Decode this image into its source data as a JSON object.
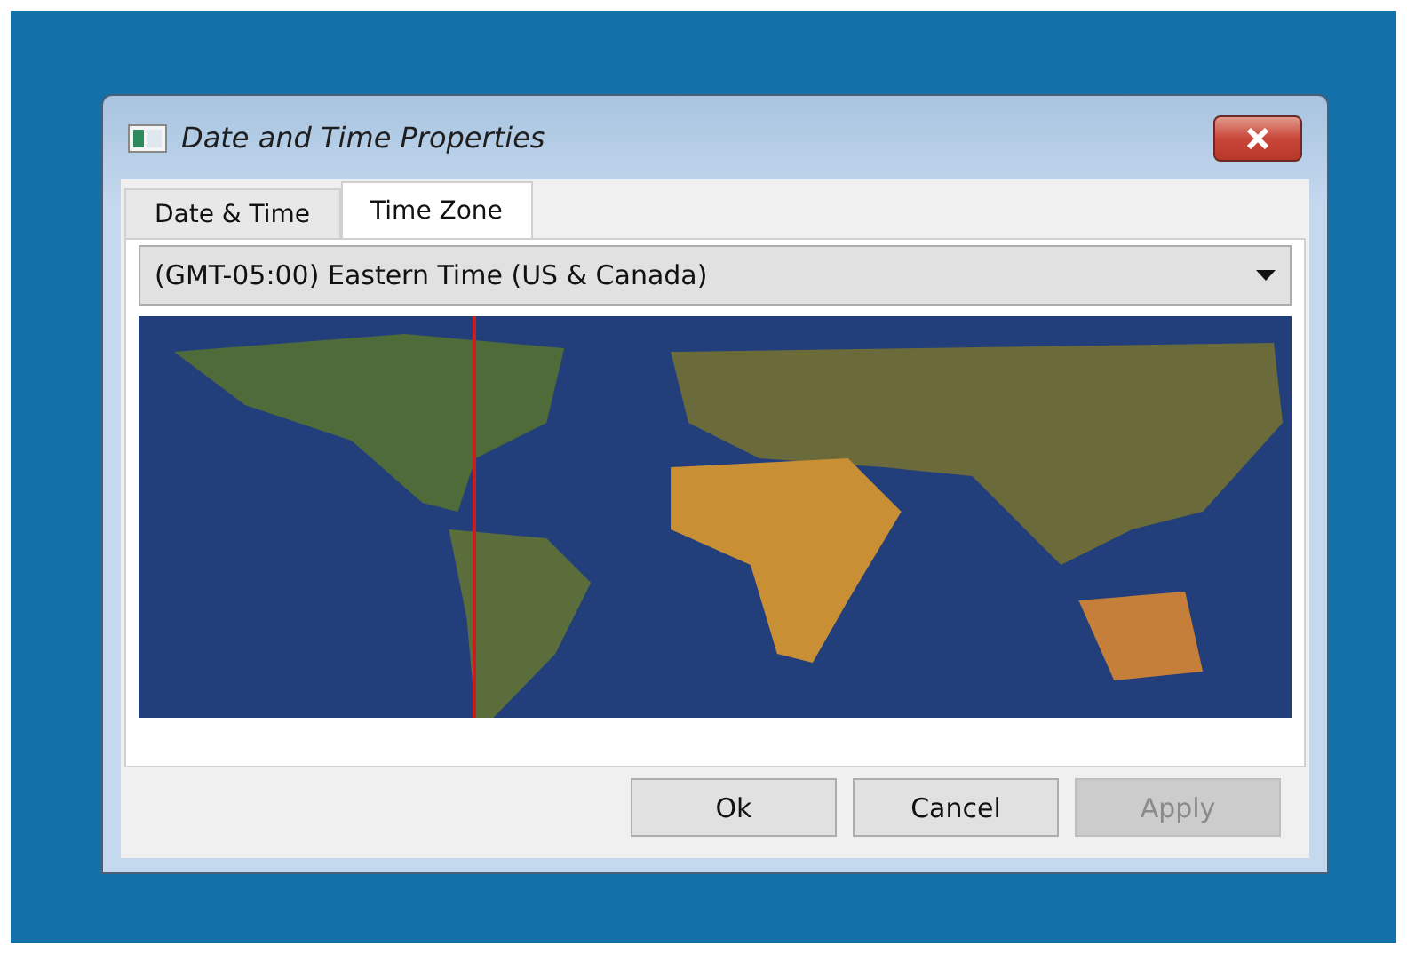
{
  "window": {
    "title": "Date and Time Properties"
  },
  "tabs": [
    {
      "label": "Date & Time",
      "selected": false
    },
    {
      "label": "Time Zone",
      "selected": true
    }
  ],
  "timezone_dropdown": {
    "value": "(GMT-05:00) Eastern Time (US & Canada)"
  },
  "buttons": [
    {
      "label": "Ok",
      "disabled": false
    },
    {
      "label": "Cancel",
      "disabled": false
    },
    {
      "label": "Apply",
      "disabled": true
    }
  ]
}
